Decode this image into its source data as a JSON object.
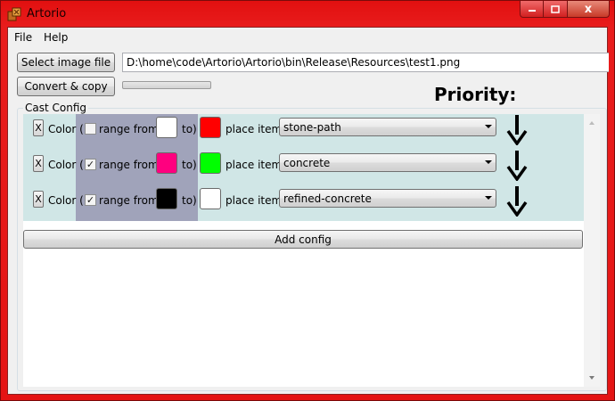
{
  "window": {
    "title": "Artorio",
    "minimize_icon": "minimize-icon",
    "maximize_icon": "maximize-icon",
    "close_icon": "close-icon",
    "close_glyph": "x"
  },
  "menu": [
    "File",
    "Help"
  ],
  "toolbar": {
    "select_label": "Select image file",
    "path_value": "D:\\home\\code\\Artorio\\Artorio\\bin\\Release\\Resources\\test1.png",
    "convert_label": "Convert & copy",
    "progress": 0
  },
  "priority_label": "Priority:",
  "cast_config": {
    "title": "Cast Config",
    "remove_label": "X",
    "color_label": "Color (",
    "range_from_label": "range from",
    "range_to_label": "to)",
    "place_item_label": "place item",
    "rows": [
      {
        "range_checked": false,
        "from_color": "#ffffff",
        "to_color": "#ff0000",
        "item": "stone-path"
      },
      {
        "range_checked": true,
        "from_color": "#ff007f",
        "to_color": "#00ff00",
        "item": "concrete"
      },
      {
        "range_checked": true,
        "from_color": "#000000",
        "to_color": "#ffffff",
        "item": "refined-concrete"
      }
    ],
    "add_label": "Add config"
  },
  "colors": {
    "titlebar": "#e81c1c",
    "row_background": "#d0e6e6",
    "range_background": "#a0a3ba"
  }
}
